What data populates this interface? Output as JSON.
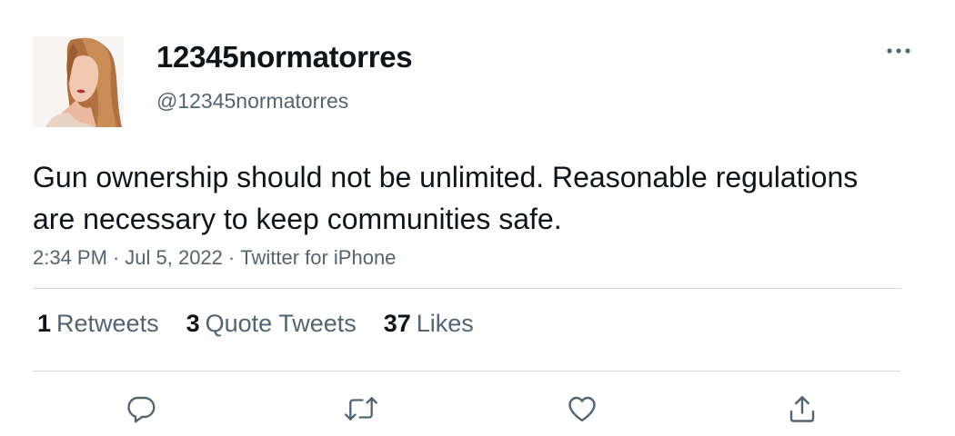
{
  "tweet": {
    "author": {
      "display_name": "12345normatorres",
      "handle": "@12345normatorres",
      "avatar_icon": "profile-photo"
    },
    "text": "Gun ownership should not be unlimited. Reasonable regulations are necessary to keep communities safe.",
    "meta": {
      "time": "2:34 PM",
      "separator": "·",
      "date": "Jul 5, 2022",
      "source": "Twitter for iPhone"
    },
    "stats": [
      {
        "count": "1",
        "label": "Retweets"
      },
      {
        "count": "3",
        "label": "Quote Tweets"
      },
      {
        "count": "37",
        "label": "Likes"
      }
    ],
    "actions": [
      {
        "icon": "reply-icon"
      },
      {
        "icon": "retweet-icon"
      },
      {
        "icon": "like-icon"
      },
      {
        "icon": "share-icon"
      }
    ],
    "more_icon": "more-icon"
  },
  "colors": {
    "primary_text": "#0f1419",
    "secondary_text": "#536471",
    "divider": "#cfd9de"
  }
}
